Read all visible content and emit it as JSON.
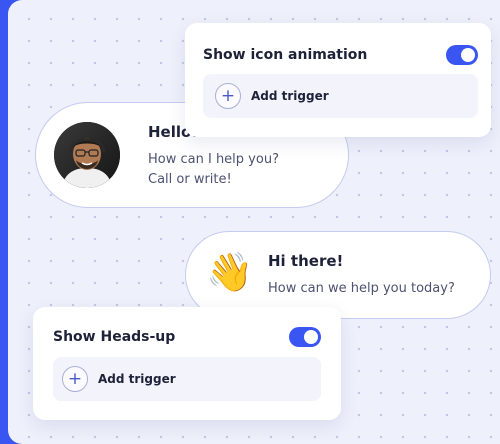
{
  "icon_animation_card": {
    "title": "Show icon animation",
    "toggle_on": true,
    "trigger_label": "Add trigger",
    "plus_icon": "+"
  },
  "chat_hello": {
    "title": "Hello!",
    "line1": "How can I help you?",
    "line2": "Call or write!"
  },
  "chat_hi": {
    "title": "Hi there!",
    "text": "How can we help you today?",
    "emoji": "👋"
  },
  "headsup_card": {
    "title": "Show Heads-up",
    "toggle_on": true,
    "trigger_label": "Add trigger",
    "plus_icon": "+"
  },
  "colors": {
    "accent": "#3a56f2",
    "background": "#eef0fb",
    "bubble_border": "#c4cbef"
  }
}
